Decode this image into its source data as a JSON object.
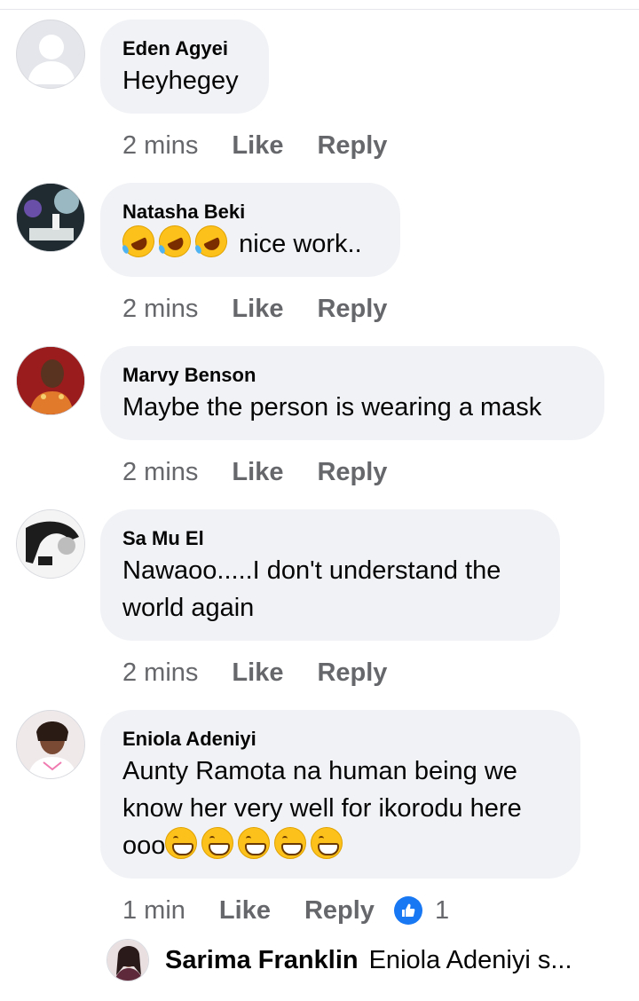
{
  "comments": [
    {
      "name": "Eden Agyei",
      "text": "Heyhegey",
      "time": "2 mins",
      "like": "Like",
      "reply": "Reply"
    },
    {
      "name": "Natasha Beki",
      "text": "nice work..",
      "time": "2 mins",
      "like": "Like",
      "reply": "Reply"
    },
    {
      "name": "Marvy Benson",
      "text": "Maybe the person is wearing a mask",
      "time": "2 mins",
      "like": "Like",
      "reply": "Reply"
    },
    {
      "name": "Sa Mu El",
      "text_line1": "Nawaoo.....I don't understand the",
      "text_line2": "world again",
      "time": "2 mins",
      "like": "Like",
      "reply": "Reply"
    },
    {
      "name": "Eniola Adeniyi",
      "text_line1": "Aunty Ramota na human being we",
      "text_line2": "know her very well for ikorodu here",
      "text_line3": "ooo",
      "time": "1 min",
      "like": "Like",
      "reply": "Reply",
      "reaction_count": "1"
    }
  ],
  "reply_preview": {
    "name": "Sarima Franklin",
    "text": "Eniola Adeniyi s..."
  },
  "colors": {
    "bubble": "#f0f2f5",
    "meta": "#65676b",
    "like_badge": "#1877f2"
  },
  "icons": {
    "reaction": "like-thumb-icon",
    "emoji_rofl": "rolling-on-floor-laughing-emoji",
    "emoji_grin": "beaming-face-emoji"
  }
}
